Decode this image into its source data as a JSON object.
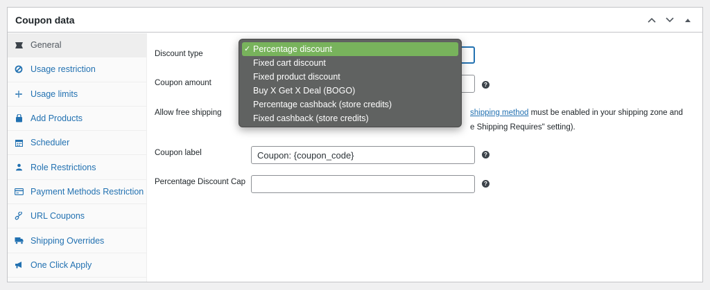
{
  "panel": {
    "title": "Coupon data"
  },
  "sidebar": {
    "items": [
      {
        "label": "General",
        "icon": "wrench-icon",
        "active": true
      },
      {
        "label": "Usage restriction",
        "icon": "restriction-icon"
      },
      {
        "label": "Usage limits",
        "icon": "limits-icon"
      },
      {
        "label": "Add Products",
        "icon": "cart-icon"
      },
      {
        "label": "Scheduler",
        "icon": "calendar-icon"
      },
      {
        "label": "Role Restrictions",
        "icon": "user-icon"
      },
      {
        "label": "Payment Methods Restriction",
        "icon": "card-icon"
      },
      {
        "label": "URL Coupons",
        "icon": "link-icon"
      },
      {
        "label": "Shipping Overrides",
        "icon": "truck-icon"
      },
      {
        "label": "One Click Apply",
        "icon": "megaphone-icon"
      }
    ]
  },
  "form": {
    "discount_type_label": "Discount type",
    "coupon_amount_label": "Coupon amount",
    "free_shipping_label": "Allow free shipping",
    "free_shipping_desc_link": "shipping method",
    "free_shipping_desc_line1_rest": " must be enabled in your shipping zone and",
    "free_shipping_desc_line2": "e Shipping Requires\" setting).",
    "coupon_label_label": "Coupon label",
    "coupon_label_value": "Coupon: {coupon_code}",
    "discount_cap_label": "Percentage Discount Cap",
    "discount_cap_value": "",
    "help_glyph": "?"
  },
  "dropdown": {
    "check_glyph": "✓",
    "options": [
      "Percentage discount",
      "Fixed cart discount",
      "Fixed product discount",
      "Buy X Get X Deal (BOGO)",
      "Percentage cashback (store credits)",
      "Fixed cashback (store credits)"
    ],
    "selected_index": 0
  },
  "colors": {
    "accent": "#2271b1",
    "selected_option": "#78b35c",
    "dropdown_bg": "#606261"
  }
}
